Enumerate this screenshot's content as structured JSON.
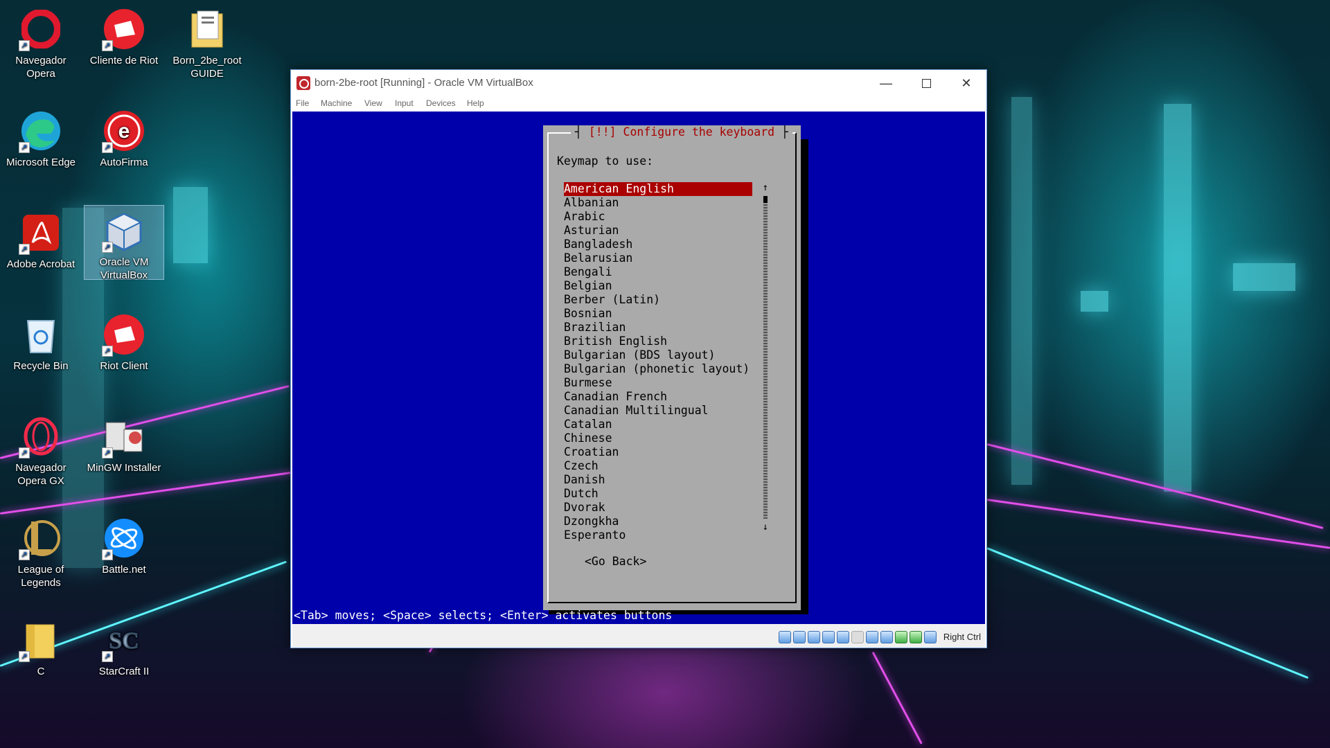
{
  "desktop": {
    "icons": [
      {
        "label": "Navegador Opera",
        "icon": "opera-icon",
        "color": "#e0192e"
      },
      {
        "label": "Cliente de Riot",
        "icon": "riot-icon",
        "color": "#e8232d"
      },
      {
        "label": "Born_2be_root GUIDE",
        "icon": "document-folder-icon",
        "color": "#f2d16b"
      },
      {
        "label": "Microsoft Edge",
        "icon": "edge-icon",
        "color": "#1fa4d8"
      },
      {
        "label": "AutoFirma",
        "icon": "autofirma-icon",
        "color": "#e01e25"
      },
      {
        "label": "Adobe Acrobat",
        "icon": "acrobat-icon",
        "color": "#d41f16"
      },
      {
        "label": "Oracle VM VirtualBox",
        "icon": "virtualbox-icon",
        "color": "#2f6fb5"
      },
      {
        "label": "Recycle Bin",
        "icon": "recycle-bin-icon",
        "color": "#cfe5f3"
      },
      {
        "label": "Riot Client",
        "icon": "riot-icon",
        "color": "#e8232d"
      },
      {
        "label": "Navegador Opera GX",
        "icon": "opera-gx-icon",
        "color": "#f22a4a"
      },
      {
        "label": "MinGW Installer",
        "icon": "mingw-icon",
        "color": "#c8c8c8"
      },
      {
        "label": "League of Legends",
        "icon": "league-icon",
        "color": "#c8a04a"
      },
      {
        "label": "Battle.net",
        "icon": "battlenet-icon",
        "color": "#148eff"
      },
      {
        "label": "C",
        "icon": "folder-icon",
        "color": "#f3cf5c"
      },
      {
        "label": "StarCraft II",
        "icon": "starcraft-icon",
        "color": "#b8d4ef"
      }
    ]
  },
  "window": {
    "title": "born-2be-root [Running] - Oracle VM VirtualBox",
    "menu": [
      "File",
      "Machine",
      "View",
      "Input",
      "Devices",
      "Help"
    ]
  },
  "installer": {
    "dialog_title": "[!!] Configure the keyboard",
    "prompt": "Keymap to use:",
    "keymaps": [
      "American English",
      "Albanian",
      "Arabic",
      "Asturian",
      "Bangladesh",
      "Belarusian",
      "Bengali",
      "Belgian",
      "Berber (Latin)",
      "Bosnian",
      "Brazilian",
      "British English",
      "Bulgarian (BDS layout)",
      "Bulgarian (phonetic layout)",
      "Burmese",
      "Canadian French",
      "Canadian Multilingual",
      "Catalan",
      "Chinese",
      "Croatian",
      "Czech",
      "Danish",
      "Dutch",
      "Dvorak",
      "Dzongkha",
      "Esperanto"
    ],
    "selected_index": 0,
    "go_back": "<Go Back>",
    "hint": "<Tab> moves; <Space> selects; <Enter> activates buttons",
    "colors": {
      "screen": "#0000aa",
      "dialog": "#aaaaaa",
      "selection": "#aa0000",
      "title": "#a80000"
    }
  },
  "statusbar": {
    "host_key": "Right Ctrl"
  }
}
